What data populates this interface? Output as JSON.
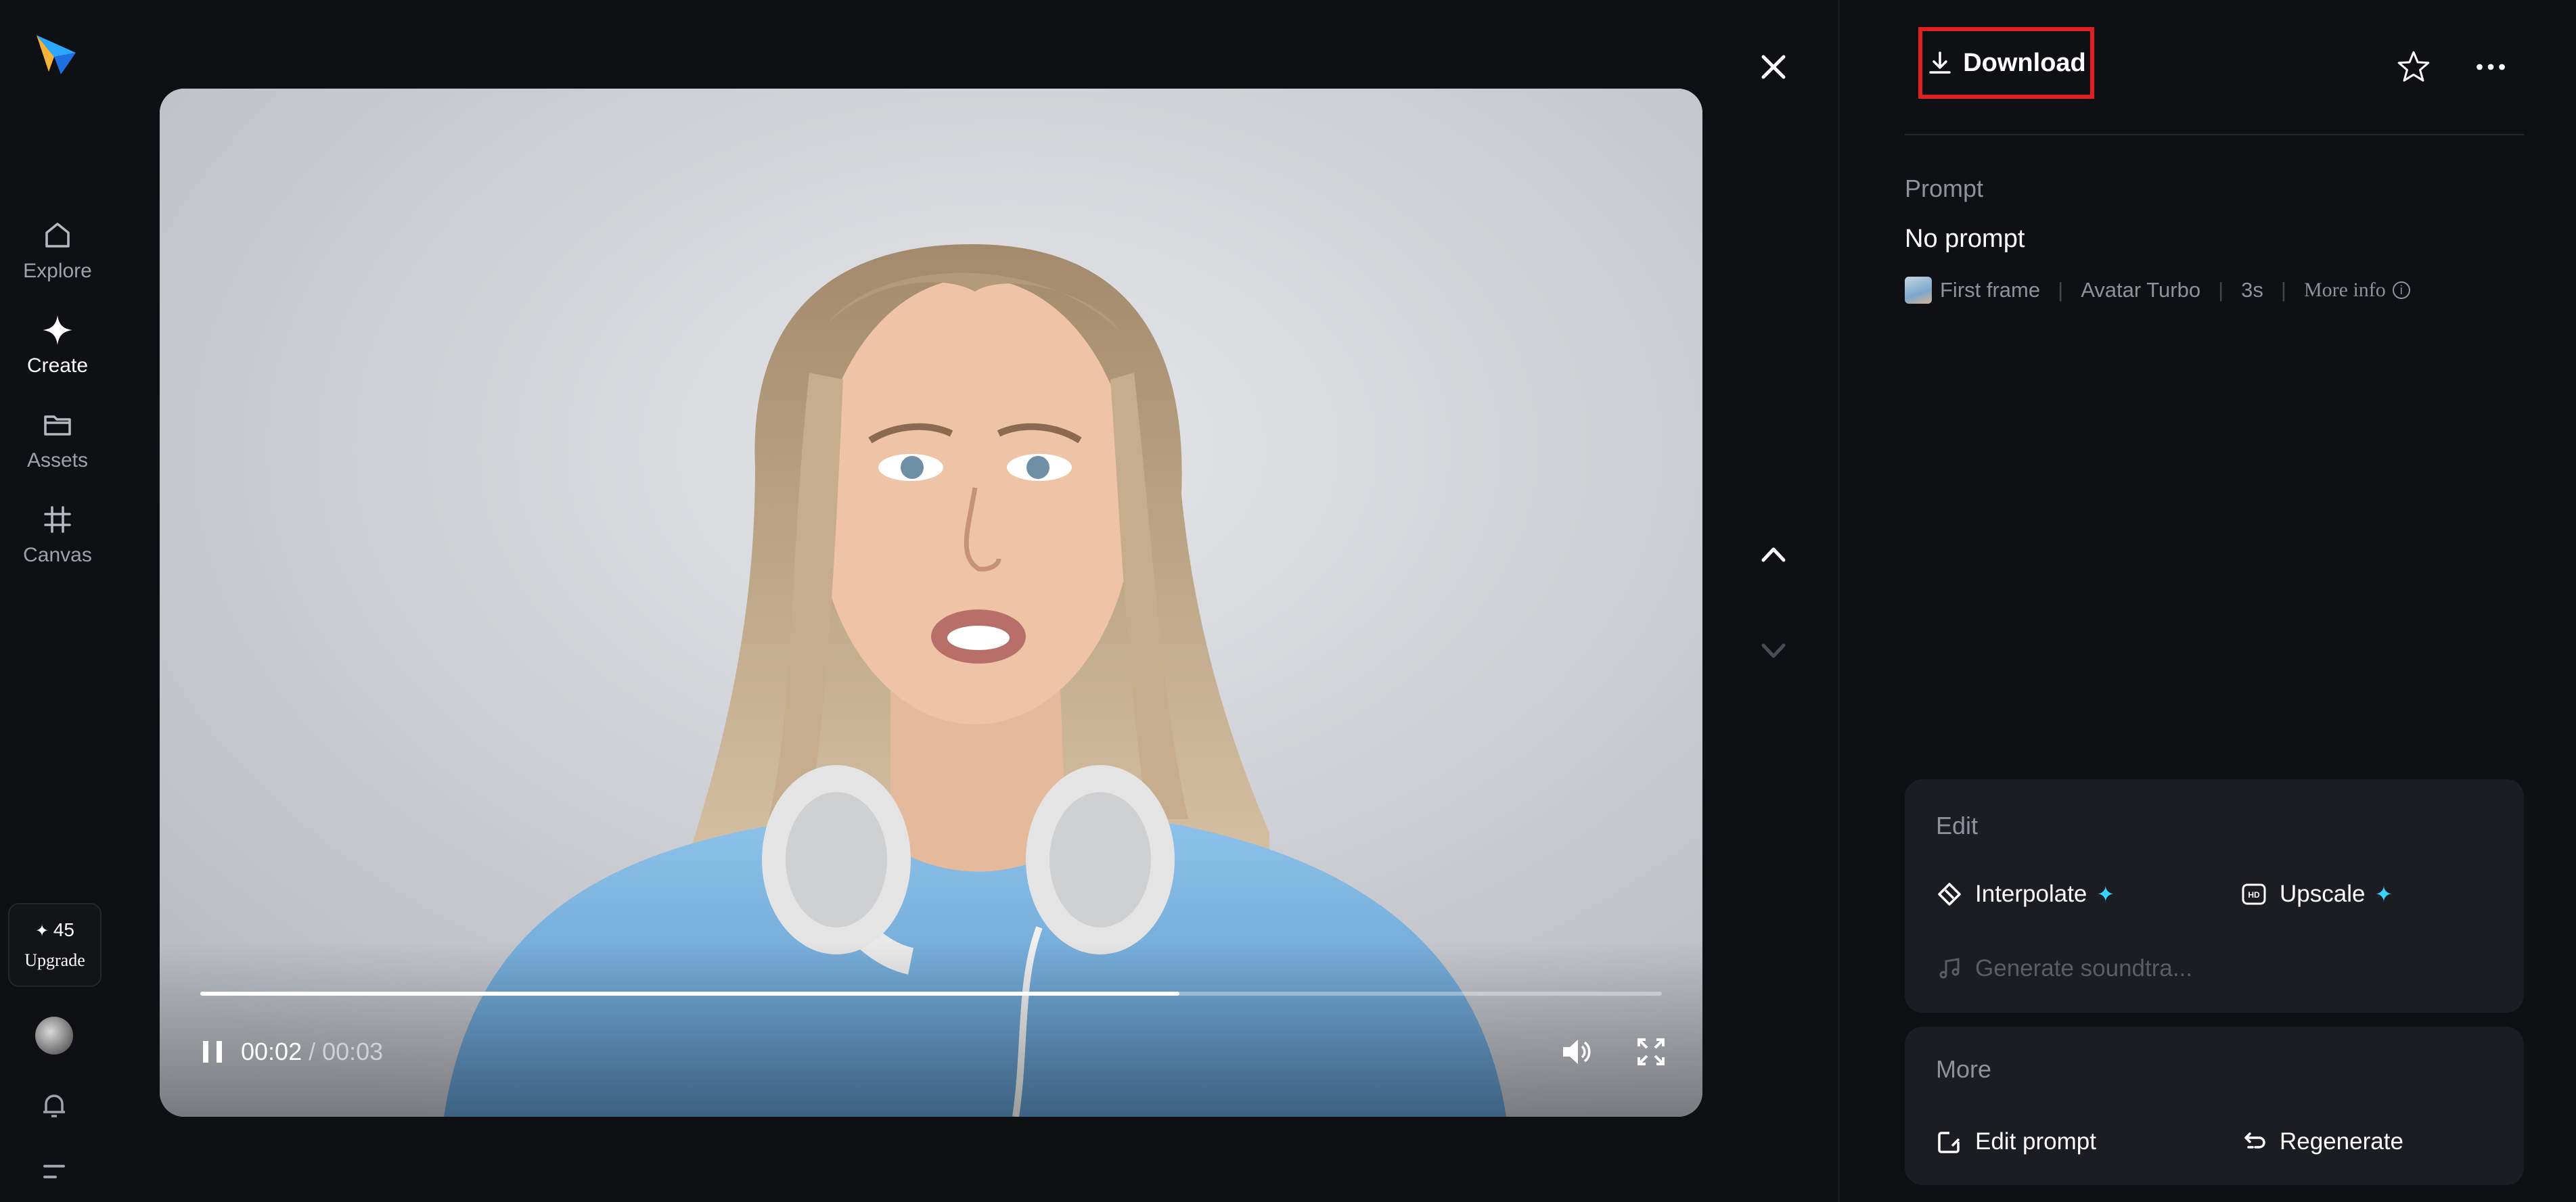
{
  "nav": {
    "items": [
      {
        "label": "Explore",
        "icon": "home-icon"
      },
      {
        "label": "Create",
        "icon": "sparkle-icon",
        "active": true
      },
      {
        "label": "Assets",
        "icon": "folder-icon"
      },
      {
        "label": "Canvas",
        "icon": "grid-icon"
      }
    ],
    "credits": "45",
    "upgrade_label": "Upgrade"
  },
  "player": {
    "current_time": "00:02",
    "total_time": "/ 00:03",
    "progress_fraction": 0.67
  },
  "toolbar": {
    "download_label": "Download"
  },
  "details": {
    "prompt_heading": "Prompt",
    "prompt_value": "No prompt",
    "meta": {
      "first_frame": "First frame",
      "model": "Avatar Turbo",
      "duration": "3s",
      "more_info": "More info"
    }
  },
  "edit_card": {
    "heading": "Edit",
    "interpolate": "Interpolate",
    "upscale": "Upscale",
    "soundtrack": "Generate soundtra..."
  },
  "more_card": {
    "heading": "More",
    "edit_prompt": "Edit prompt",
    "regenerate": "Regenerate"
  },
  "colors": {
    "background": "#0f1013",
    "card": "#1c1d22",
    "highlight": "#e02020",
    "accent": "#39d2ff"
  }
}
